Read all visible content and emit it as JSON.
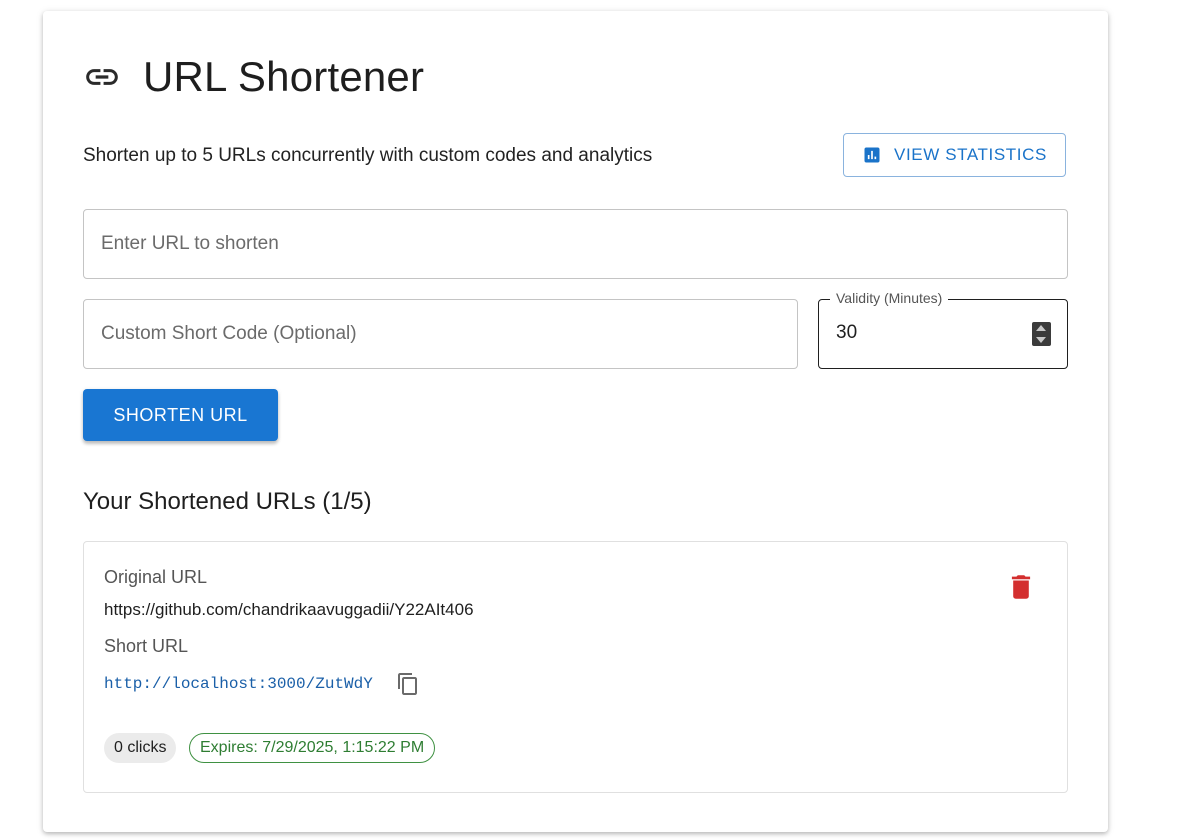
{
  "header": {
    "icon": "link-icon",
    "title": "URL Shortener",
    "subtitle": "Shorten up to 5 URLs concurrently with custom codes and analytics",
    "stats_button": "VIEW STATISTICS",
    "stats_icon": "bar-chart-icon"
  },
  "form": {
    "url_placeholder": "Enter URL to shorten",
    "url_value": "",
    "code_placeholder": "Custom Short Code (Optional)",
    "code_value": "",
    "validity_label": "Validity (Minutes)",
    "validity_value": "30",
    "submit_label": "SHORTEN URL"
  },
  "results": {
    "title": "Your Shortened URLs (1/5)",
    "items": [
      {
        "original_label": "Original URL",
        "original_url": "https://github.com/chandrikaavuggadii/Y22AIt406",
        "short_label": "Short URL",
        "short_url": "http://localhost:3000/ZutWdY",
        "clicks": "0 clicks",
        "expires": "Expires: 7/29/2025, 1:15:22 PM"
      }
    ]
  },
  "colors": {
    "primary": "#1976d2",
    "link": "#1a5fa8",
    "delete": "#d32f2f",
    "success": "#2e7d32"
  }
}
